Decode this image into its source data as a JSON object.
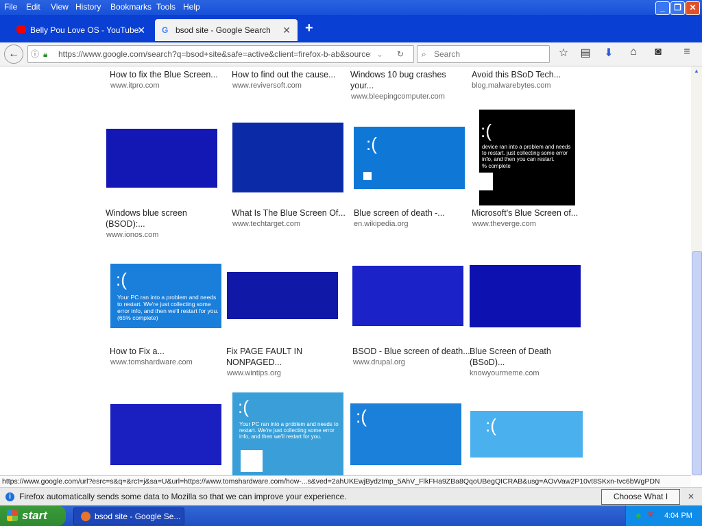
{
  "menu": [
    "File",
    "Edit",
    "View",
    "History",
    "Bookmarks",
    "Tools",
    "Help"
  ],
  "tabs": [
    {
      "title": "Belly Pou Love OS - YouTube"
    },
    {
      "title": "bsod site - Google Search"
    }
  ],
  "url": "https://www.google.com/search?q=bsod+site&safe=active&client=firefox-b-ab&source=lnms",
  "search_placeholder": "Search",
  "results": [
    {
      "title": "How to fix the Blue Screen...",
      "source": "www.itpro.com"
    },
    {
      "title": "How to find out the cause...",
      "source": "www.reviversoft.com"
    },
    {
      "title": "Windows 10 bug crashes",
      "title2": "your...",
      "source": "www.bleepingcomputer.com"
    },
    {
      "title": "Avoid this BSoD Tech...",
      "source": "blog.malwarebytes.com"
    },
    {
      "title": "Windows blue screen",
      "title2": "(BSOD):...",
      "source": "www.ionos.com"
    },
    {
      "title": "What Is The Blue Screen Of...",
      "source": "www.techtarget.com"
    },
    {
      "title": "Blue screen of death -...",
      "source": "en.wikipedia.org"
    },
    {
      "title": "Microsoft's Blue Screen of...",
      "source": "www.theverge.com"
    },
    {
      "title": "How to Fix a...",
      "source": "www.tomshardware.com"
    },
    {
      "title": "Fix PAGE FAULT IN",
      "title2": "NONPAGED...",
      "source": "www.wintips.org"
    },
    {
      "title": "BSOD - Blue screen of death...",
      "source": "www.drupal.org"
    },
    {
      "title": "Blue Screen of Death",
      "title2": "(BSoD)...",
      "source": "knowyourmeme.com"
    }
  ],
  "thumb_text": {
    "t1": "Your PC ran into a problem and needs to restart. We're just collecting some error info, and then we'll restart for you. (65% complete)",
    "t2": "Your PC ran into a problem and needs to restart. We're just collecting some error info, and then we'll restart for you.",
    "t3": "device ran into a problem and needs to restart. just collecting some error info, and then you can restart.",
    "complete": "% complete",
    "smile": ":("
  },
  "status_url": "https://www.google.com/url?esrc=s&q=&rct=j&sa=U&url=https://www.tomshardware.com/how-...s&ved=2ahUKEwjBydztmp_5AhV_FlkFHa9ZBa8QqoUBegQICRAB&usg=AOvVaw2P10vt8SKxn-tvc6bWgPDN",
  "notification": {
    "text": "Firefox automatically sends some data to Mozilla so that we can improve your experience.",
    "button": "Choose What I Share"
  },
  "taskbar": {
    "start": "start",
    "item": "bsod site - Google Se...",
    "time": "4:04 PM"
  },
  "colors": {
    "titlebar": "#1750d8",
    "bsod_blue": "#0a0fa8",
    "win10_blue": "#0f78d7"
  }
}
